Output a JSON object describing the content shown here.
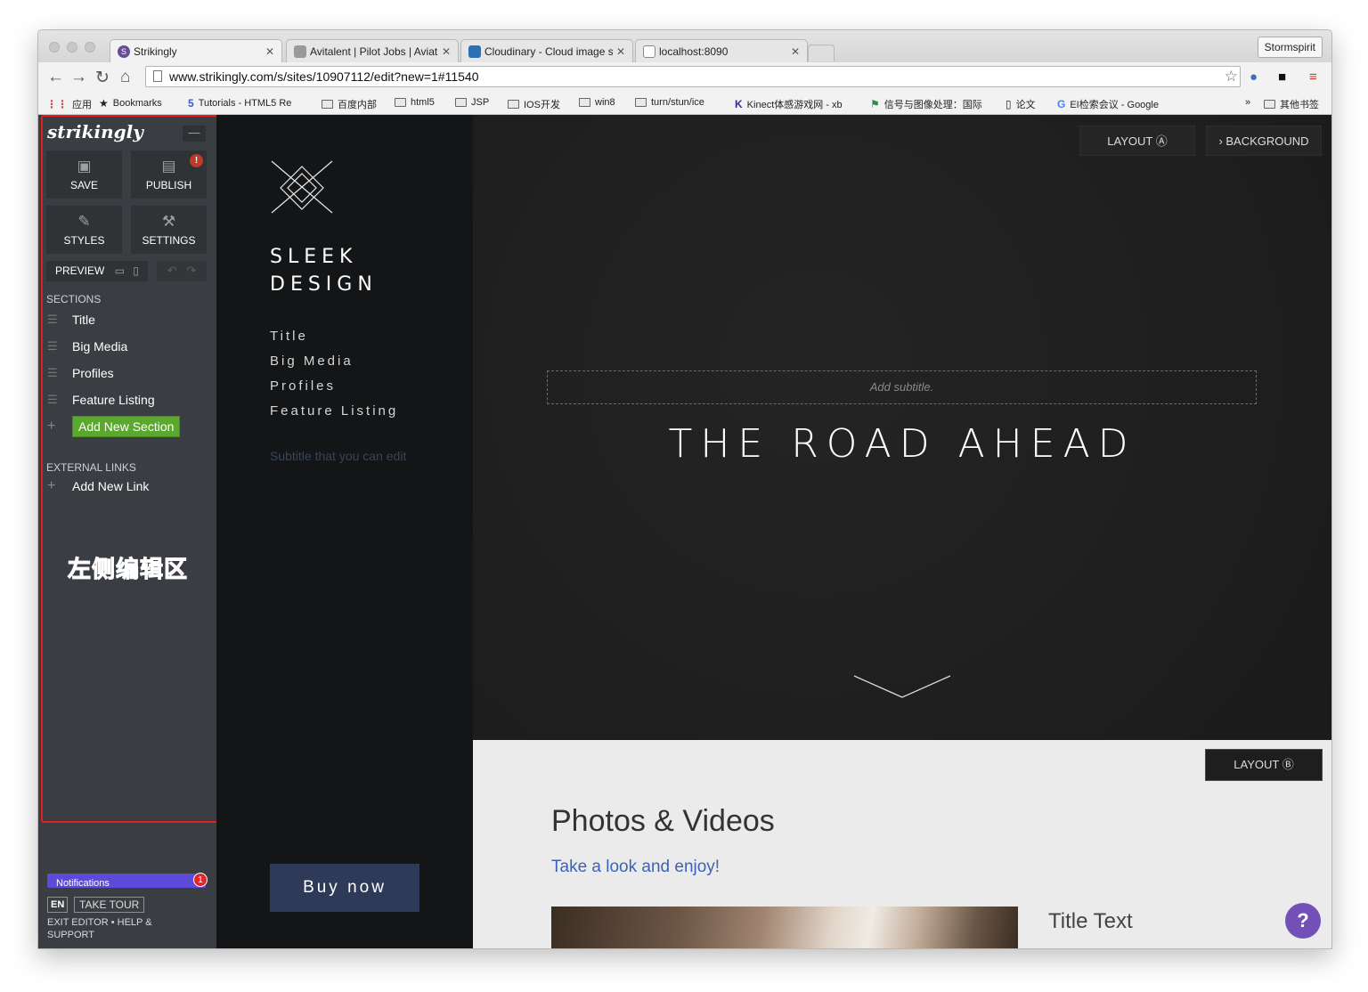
{
  "browser": {
    "tabs": [
      {
        "title": "Strikingly",
        "favicon_color": "#6a4c93",
        "favicon_letter": "S"
      },
      {
        "title": "Avitalent | Pilot Jobs | Aviat",
        "favicon_color": "#9a9a9a",
        "favicon_letter": ""
      },
      {
        "title": "Cloudinary - Cloud image s",
        "favicon_color": "#2d6fb7",
        "favicon_letter": ""
      },
      {
        "title": "localhost:8090",
        "favicon_color": "#ffffff",
        "favicon_letter": ""
      }
    ],
    "profile": "Stormspirit",
    "url": "www.strikingly.com/s/sites/10907112/edit?new=1#11540",
    "bookmarks": [
      {
        "label": "应用",
        "icon": "apps-grid-icon"
      },
      {
        "label": "Bookmarks",
        "icon": "star-icon"
      },
      {
        "label": "Tutorials - HTML5 Re",
        "icon": "html5-icon"
      },
      {
        "label": "百度内部",
        "icon": "folder-icon"
      },
      {
        "label": "html5",
        "icon": "folder-icon"
      },
      {
        "label": "JSP",
        "icon": "folder-icon"
      },
      {
        "label": "IOS开发",
        "icon": "folder-icon"
      },
      {
        "label": "win8",
        "icon": "folder-icon"
      },
      {
        "label": "turn/stun/ice",
        "icon": "folder-icon"
      },
      {
        "label": "Kinect体感游戏网 - xb",
        "icon": "k-logo-icon"
      },
      {
        "label": "信号与图像处理：国际",
        "icon": "site-icon"
      },
      {
        "label": "论文",
        "icon": "page-icon"
      },
      {
        "label": "EI检索会议 - Google",
        "icon": "google-icon"
      }
    ],
    "bookmarks_more": "»",
    "other_bookmarks": "其他书签"
  },
  "editor": {
    "logo": "strikingly",
    "save": "SAVE",
    "publish": "PUBLISH",
    "publish_badge": "!",
    "styles": "STYLES",
    "settings": "SETTINGS",
    "preview": "PREVIEW",
    "sections_header": "SECTIONS",
    "sections": [
      "Title",
      "Big Media",
      "Profiles",
      "Feature Listing"
    ],
    "add_section": "Add New Section",
    "external_links_header": "EXTERNAL LINKS",
    "add_link": "Add New Link",
    "annotation": "左侧编辑区",
    "notifications": "Notifications",
    "notifications_count": "1",
    "lang": "EN",
    "take_tour": "TAKE TOUR",
    "exit_help": "EXIT EDITOR • HELP & SUPPORT"
  },
  "site_nav": {
    "name_line1": "SLEEK",
    "name_line2": "DESIGN",
    "links": [
      "Title",
      "Big Media",
      "Profiles",
      "Feature Listing"
    ],
    "subtitle": "Subtitle that you can edit",
    "buy": "Buy now"
  },
  "hero": {
    "layout_btn": "LAYOUT Ⓐ",
    "background_btn": "› BACKGROUND",
    "subtitle_placeholder": "Add subtitle.",
    "title": "THE ROAD AHEAD"
  },
  "content": {
    "layout_btn": "LAYOUT Ⓑ",
    "title": "Photos & Videos",
    "subtitle": "Take a look and enjoy!",
    "item_title": "Title Text",
    "help": "?"
  },
  "colors": {
    "editor_bg": "#3a3e42",
    "add_section_green": "#5ba82f",
    "annotation_red": "#ff2a1f",
    "buy_button": "#2f3a58",
    "link_blue": "#3b63b5",
    "help_purple": "#7250b8"
  }
}
